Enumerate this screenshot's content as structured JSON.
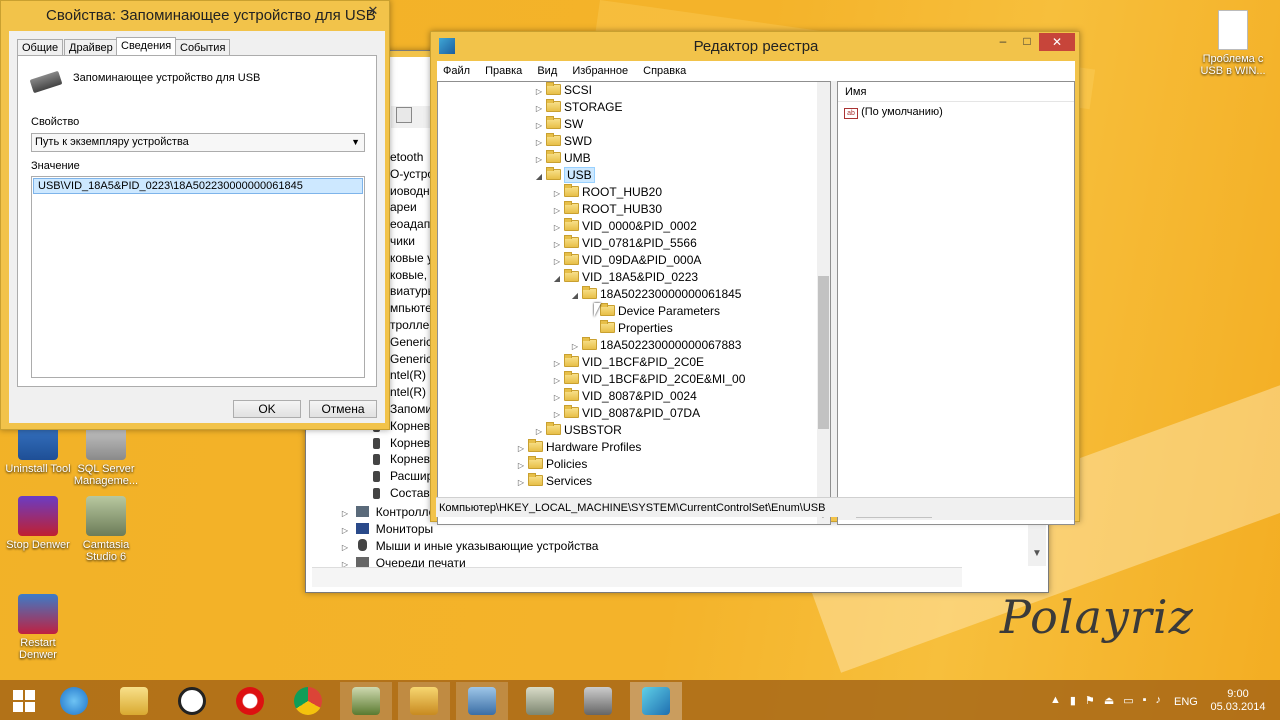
{
  "desktop": {
    "icons": [
      {
        "label": "Uninstall Tool"
      },
      {
        "label": "SQL Server Manageme..."
      },
      {
        "label": "Stop Denwer"
      },
      {
        "label": "Camtasia Studio 6"
      },
      {
        "label": "Restart Denwer"
      },
      {
        "label": "Проблема с USB в WIN..."
      }
    ],
    "watermark": "Polayriz"
  },
  "props": {
    "title": "Свойства: Запоминающее устройство для USB",
    "tabs": [
      "Общие",
      "Драйвер",
      "Сведения",
      "События"
    ],
    "device_name": "Запоминающее устройство для USB",
    "property_label": "Свойство",
    "property_value": "Путь к экземпляру устройства",
    "value_label": "Значение",
    "value": "USB\\VID_18A5&PID_0223\\18A502230000000061845",
    "ok": "OK",
    "cancel": "Отмена"
  },
  "devmgr": {
    "partial_rows": [
      "etooth",
      "O-устро",
      "иоводн",
      "ареи",
      "еоадап",
      "чики",
      "ковые у",
      "ковые, !",
      "виатурь",
      "мпьютер",
      "троллер",
      "Generic",
      "Generic",
      "ntel(R)",
      "ntel(R)",
      "Запомин",
      "Корнев",
      "Корнев",
      "Корнев",
      "Расшир",
      "Составн"
    ],
    "rows": [
      "Контроллеры",
      "Мониторы",
      "Мыши и иные указывающие устройства",
      "Очереди печати"
    ]
  },
  "regedit": {
    "title": "Редактор реестра",
    "menu": [
      "Файл",
      "Правка",
      "Вид",
      "Избранное",
      "Справка"
    ],
    "tree": [
      "SCSI",
      "STORAGE",
      "SW",
      "SWD",
      "UMB",
      "USB",
      "ROOT_HUB20",
      "ROOT_HUB30",
      "VID_0000&PID_0002",
      "VID_0781&PID_5566",
      "VID_09DA&PID_000A",
      "VID_18A5&PID_0223",
      "18A502230000000061845",
      "Device Parameters",
      "Properties",
      "18A502230000000067883",
      "VID_1BCF&PID_2C0E",
      "VID_1BCF&PID_2C0E&MI_00",
      "VID_8087&PID_0024",
      "VID_8087&PID_07DA",
      "USBSTOR",
      "Hardware Profiles",
      "Policies",
      "Services"
    ],
    "col_name": "Имя",
    "default_value": "(По умолчанию)",
    "status": "Компьютер\\HKEY_LOCAL_MACHINE\\SYSTEM\\CurrentControlSet\\Enum\\USB"
  },
  "taskbar": {
    "lang": "ENG",
    "time": "9:00",
    "date": "05.03.2014"
  }
}
